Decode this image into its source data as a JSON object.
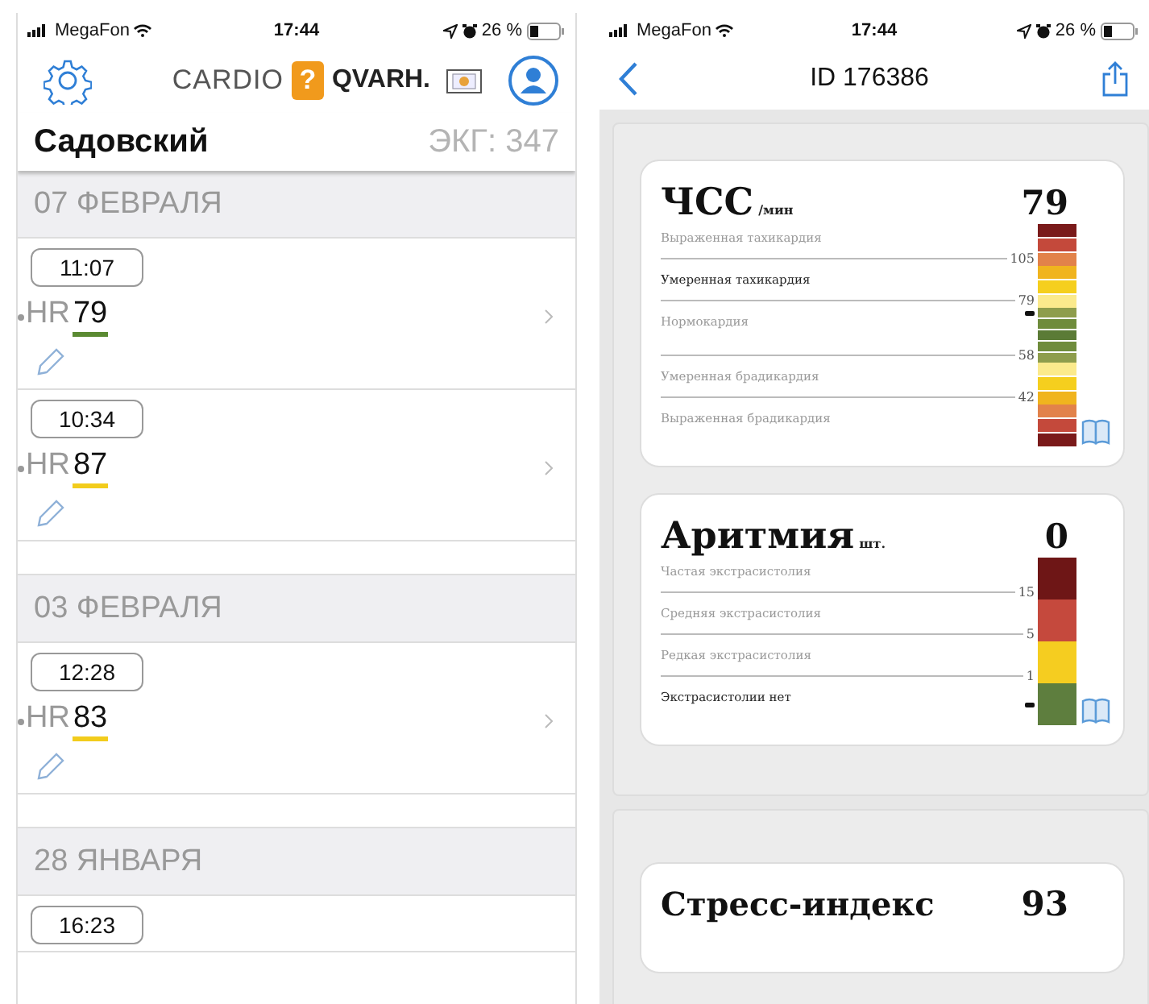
{
  "left_screen": {
    "status_bar": {
      "carrier": "MegaFon",
      "time": "17:44",
      "battery": "26 %"
    },
    "header": {
      "logo_left": "CARDIO",
      "logo_mark": "?",
      "logo_right": "QVARH."
    },
    "patient": {
      "name": "Садовский",
      "ecg_count": "ЭКГ: 347"
    },
    "sections": [
      {
        "date": "07 ФЕВРАЛЯ",
        "entries": [
          {
            "time": "11:07",
            "label": "HR",
            "value": "79",
            "color": "#5b8a32"
          },
          {
            "time": "10:34",
            "label": "HR",
            "value": "87",
            "color": "#f2cc1c"
          }
        ]
      },
      {
        "date": "03 ФЕВРАЛЯ",
        "entries": [
          {
            "time": "12:28",
            "label": "HR",
            "value": "83",
            "color": "#f2cc1c"
          }
        ]
      },
      {
        "date": "28 ЯНВАРЯ",
        "entries": [
          {
            "time": "16:23"
          }
        ]
      }
    ]
  },
  "right_screen": {
    "status_bar": {
      "carrier": "MegaFon",
      "time": "17:44",
      "battery": "26 %"
    },
    "title": "ID 176386",
    "cards": [
      {
        "title": "ЧСС",
        "unit": "/мин",
        "value": "79",
        "zones": [
          {
            "label": "Выраженная тахикардия",
            "active": false,
            "threshold": "105",
            "segments": [
              {
                "color": "#7a1a1a"
              },
              {
                "color": "#c4493b"
              },
              {
                "color": "#e2824a"
              }
            ]
          },
          {
            "label": "Умеренная тахикардия",
            "active": true,
            "threshold": "79",
            "segments": [
              {
                "color": "#f0b41e"
              },
              {
                "color": "#f5cf1e"
              },
              {
                "color": "#fbea8c"
              }
            ]
          },
          {
            "label": "Нормокардия",
            "active": false,
            "threshold": "58",
            "segments": [
              {
                "color": "#8e9d4c",
                "marked": true
              },
              {
                "color": "#6f8c3c"
              },
              {
                "color": "#5b7b36"
              },
              {
                "color": "#6f8c3c"
              },
              {
                "color": "#8e9d4c"
              }
            ]
          },
          {
            "label": "Умеренная брадикардия",
            "active": false,
            "threshold": "42",
            "segments": [
              {
                "color": "#fbea8c"
              },
              {
                "color": "#f5cf1e"
              },
              {
                "color": "#f0b41e"
              }
            ]
          },
          {
            "label": "Выраженная брадикардия",
            "active": false,
            "segments": [
              {
                "color": "#e2824a"
              },
              {
                "color": "#c4493b"
              },
              {
                "color": "#7a1a1a"
              }
            ]
          }
        ]
      },
      {
        "title": "Аритмия",
        "unit": "шт.",
        "value": "0",
        "zones": [
          {
            "label": "Частая экстрасистолия",
            "active": false,
            "threshold": "15",
            "segments": [
              {
                "color": "#6e1616"
              }
            ]
          },
          {
            "label": "Средняя экстрасистолия",
            "active": false,
            "threshold": "5",
            "segments": [
              {
                "color": "#c5493d"
              }
            ]
          },
          {
            "label": "Редкая экстрасистолия",
            "active": false,
            "threshold": "1",
            "segments": [
              {
                "color": "#f5cd20"
              }
            ]
          },
          {
            "label": "Экстрасистолии нет",
            "active": true,
            "segments": [
              {
                "color": "#5e7e3e",
                "marked": true
              }
            ]
          }
        ]
      }
    ],
    "next_card": {
      "title": "Стресс-индекс",
      "value": "93"
    }
  }
}
